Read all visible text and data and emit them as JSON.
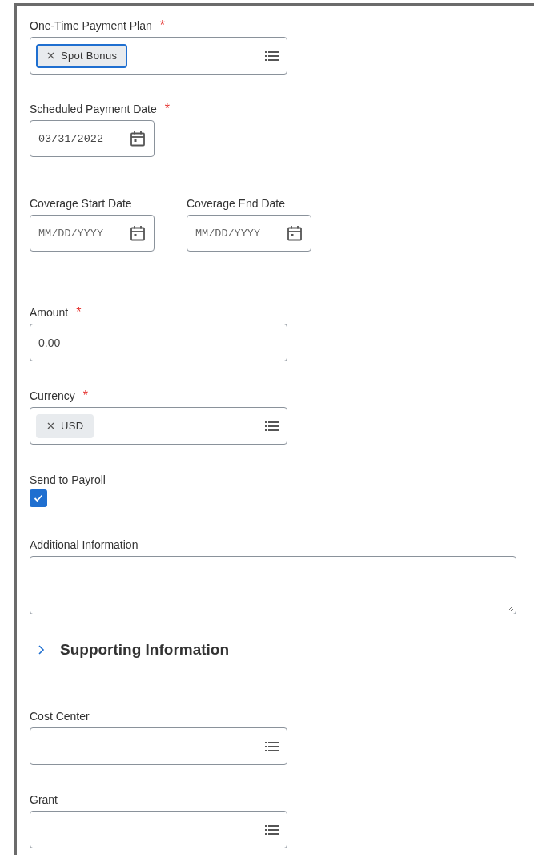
{
  "fields": [
    {
      "kind": "prompt",
      "label": "One-Time Payment Plan",
      "required_mark": "*",
      "pills": [
        {
          "text": "Spot Bonus",
          "focused": true
        }
      ]
    },
    {
      "kind": "date",
      "label": "Scheduled Payment Date",
      "required_mark": "*",
      "value": "03/31/2022"
    },
    {
      "kind": "date_pair",
      "items": [
        {
          "label": "Coverage Start Date",
          "placeholder": "MM/DD/YYYY"
        },
        {
          "label": "Coverage End Date",
          "placeholder": "MM/DD/YYYY"
        }
      ]
    },
    {
      "kind": "text",
      "label": "Amount",
      "required_mark": "*",
      "value": "0.00"
    },
    {
      "kind": "prompt",
      "label": "Currency",
      "required_mark": "*",
      "pills": [
        {
          "text": "USD",
          "focused": false
        }
      ]
    },
    {
      "kind": "checkbox",
      "label": "Send to Payroll",
      "checked": true
    },
    {
      "kind": "textarea",
      "label": "Additional Information"
    },
    {
      "kind": "section",
      "title": "Supporting Information",
      "expanded": false
    },
    {
      "kind": "prompt",
      "label": "Cost Center"
    },
    {
      "kind": "prompt",
      "label": "Grant"
    }
  ]
}
